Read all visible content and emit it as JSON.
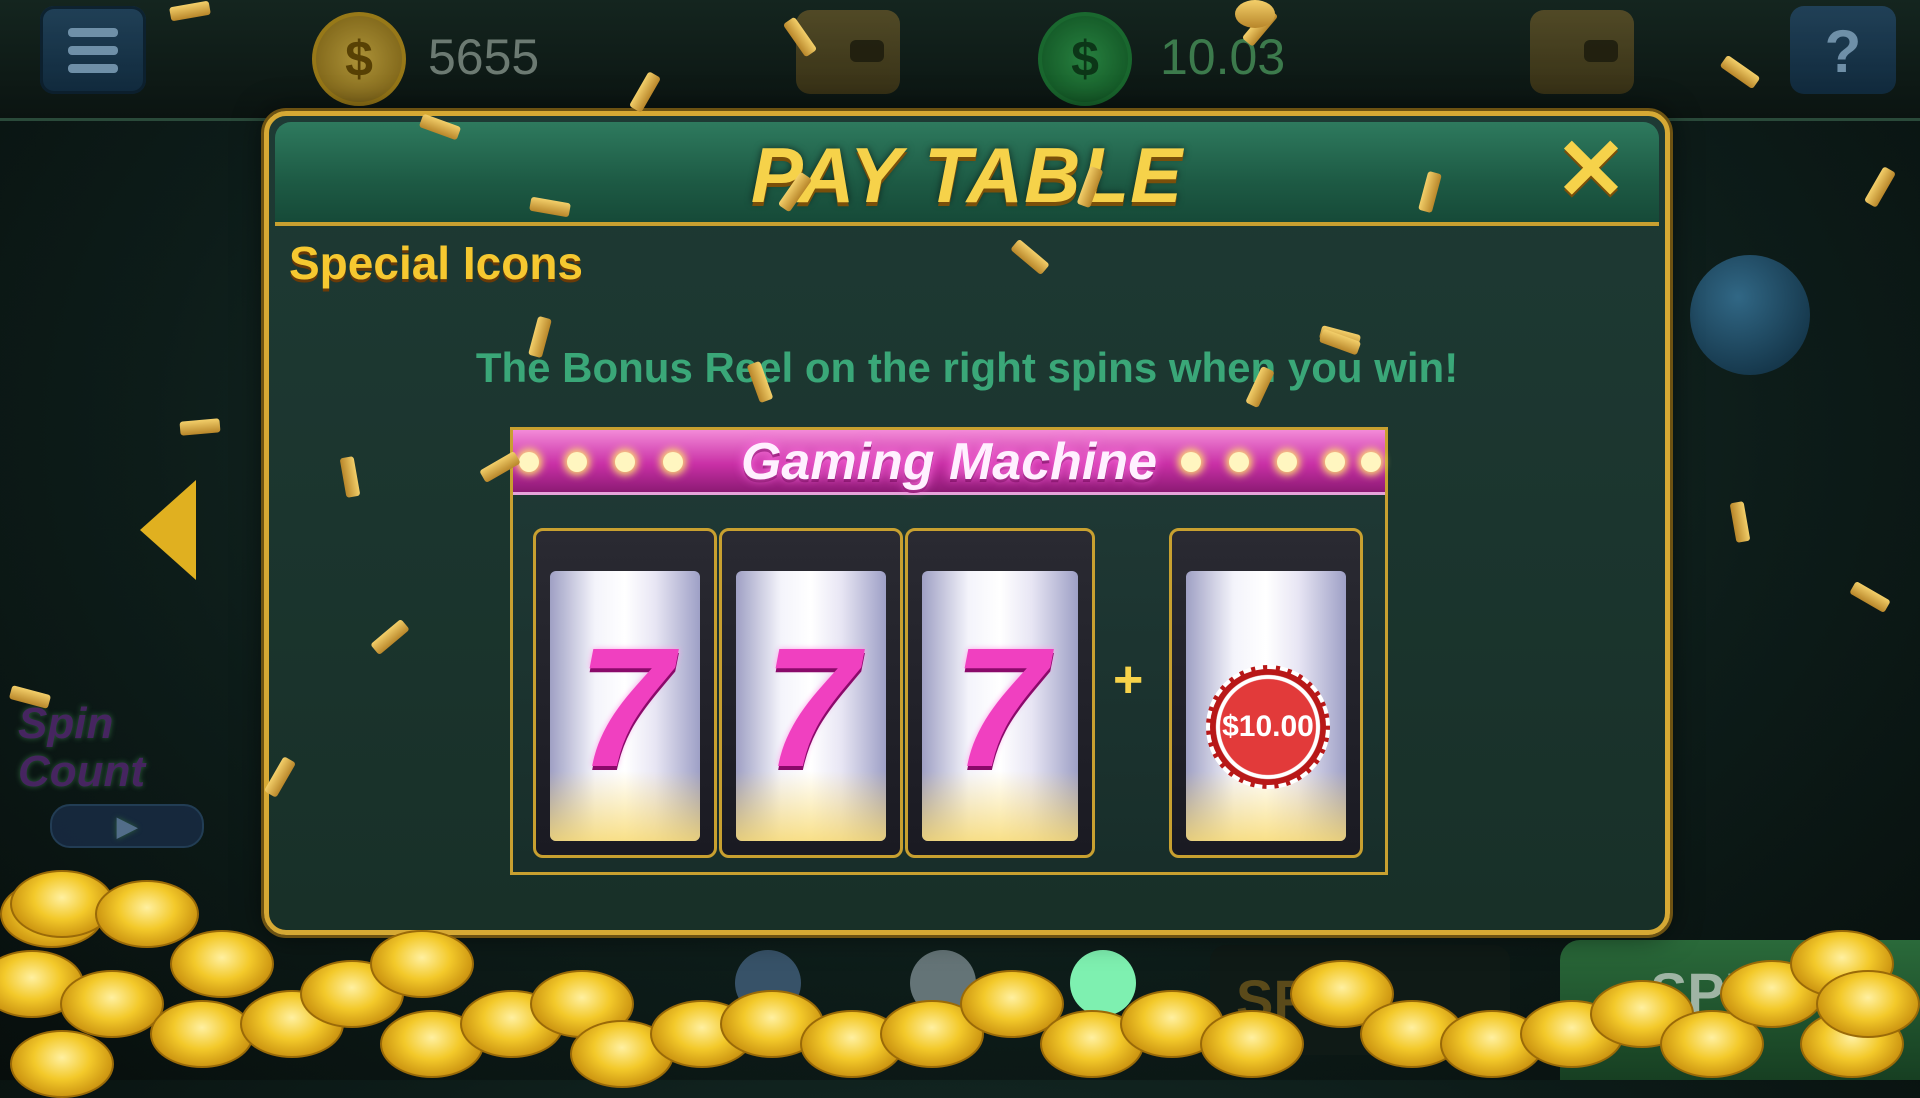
{
  "topbar": {
    "coins_balance": "5655",
    "cash_balance": "10.03",
    "coin_symbol": "$",
    "help_label": "?"
  },
  "modal": {
    "title": "PAY TABLE",
    "close_label": "✕",
    "section_title": "Special Icons",
    "description": "The Bonus Reel on the right spins when you win!",
    "machine": {
      "title": "Gaming Machine",
      "reels": [
        "7",
        "7",
        "7"
      ],
      "plus": "+",
      "bonus_value": "$10.00"
    }
  },
  "side": {
    "spin_count_label": "Spin Count",
    "play_label": "▶"
  },
  "bottom": {
    "spin_label": "SPIN",
    "spins_text": "SP   10"
  },
  "colors": {
    "gold": "#f6d24a",
    "modal_border": "#d6a934",
    "desc_green": "#3aa778",
    "magenta": "#f040c0"
  }
}
